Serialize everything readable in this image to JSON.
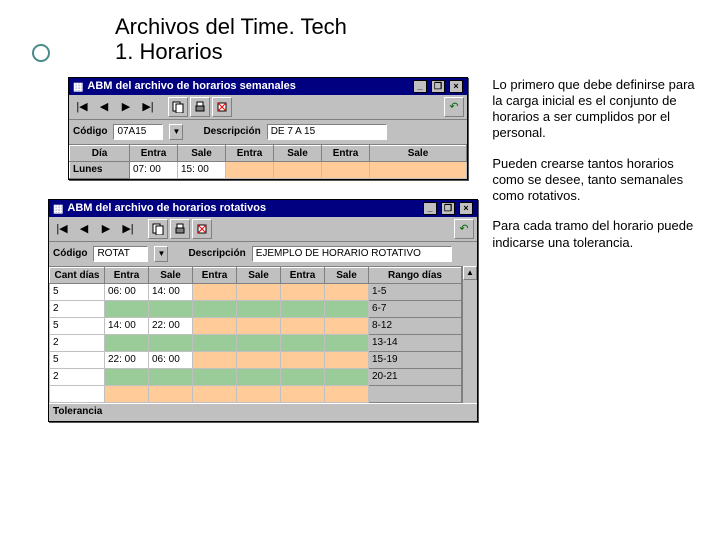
{
  "title_line1": "Archivos del Time. Tech",
  "title_line2": "1. Horarios",
  "paragraphs": [
    "Lo primero que debe definirse para la carga inicial es el conjunto de horarios a ser cumplidos por el personal.",
    "Pueden crearse tantos horarios como se desee, tanto semanales como rotativos.",
    "Para cada tramo del horario puede indicarse una tolerancia."
  ],
  "icons": {
    "min": "_",
    "restore": "❐",
    "close": "×",
    "first": "|◀",
    "prev": "◀",
    "next": "▶",
    "last": "▶|",
    "exit_arrow": "↶"
  },
  "win1": {
    "title": "ABM del archivo de horarios semanales",
    "codigo_label": "Código",
    "codigo_value": "07A15",
    "descripcion_label": "Descripción",
    "descripcion_value": "DE 7 A 15",
    "columns": [
      "Día",
      "Entra",
      "Sale",
      "Entra",
      "Sale",
      "Entra",
      "Sale"
    ],
    "row": {
      "dia": "Lunes",
      "entra1": "07: 00",
      "sale1": "15: 00"
    }
  },
  "win2": {
    "title": "ABM del archivo de horarios rotativos",
    "codigo_label": "Código",
    "codigo_value": "ROTAT",
    "descripcion_label": "Descripción",
    "descripcion_value": "EJEMPLO DE HORARIO ROTATIVO",
    "columns": [
      "Cant días",
      "Entra",
      "Sale",
      "Entra",
      "Sale",
      "Entra",
      "Sale",
      "Rango días"
    ],
    "rows": [
      {
        "cant": "5",
        "entra1": "06: 00",
        "sale1": "14: 00",
        "rango": "1-5"
      },
      {
        "cant": "2",
        "rango": "6-7"
      },
      {
        "cant": "5",
        "entra1": "14: 00",
        "sale1": "22: 00",
        "rango": "8-12"
      },
      {
        "cant": "2",
        "rango": "13-14"
      },
      {
        "cant": "5",
        "entra1": "22: 00",
        "sale1": "06: 00",
        "rango": "15-19"
      },
      {
        "cant": "2",
        "rango": "20-21"
      },
      {
        "cant": "",
        "rango": ""
      }
    ],
    "status_label": "Tolerancia"
  }
}
